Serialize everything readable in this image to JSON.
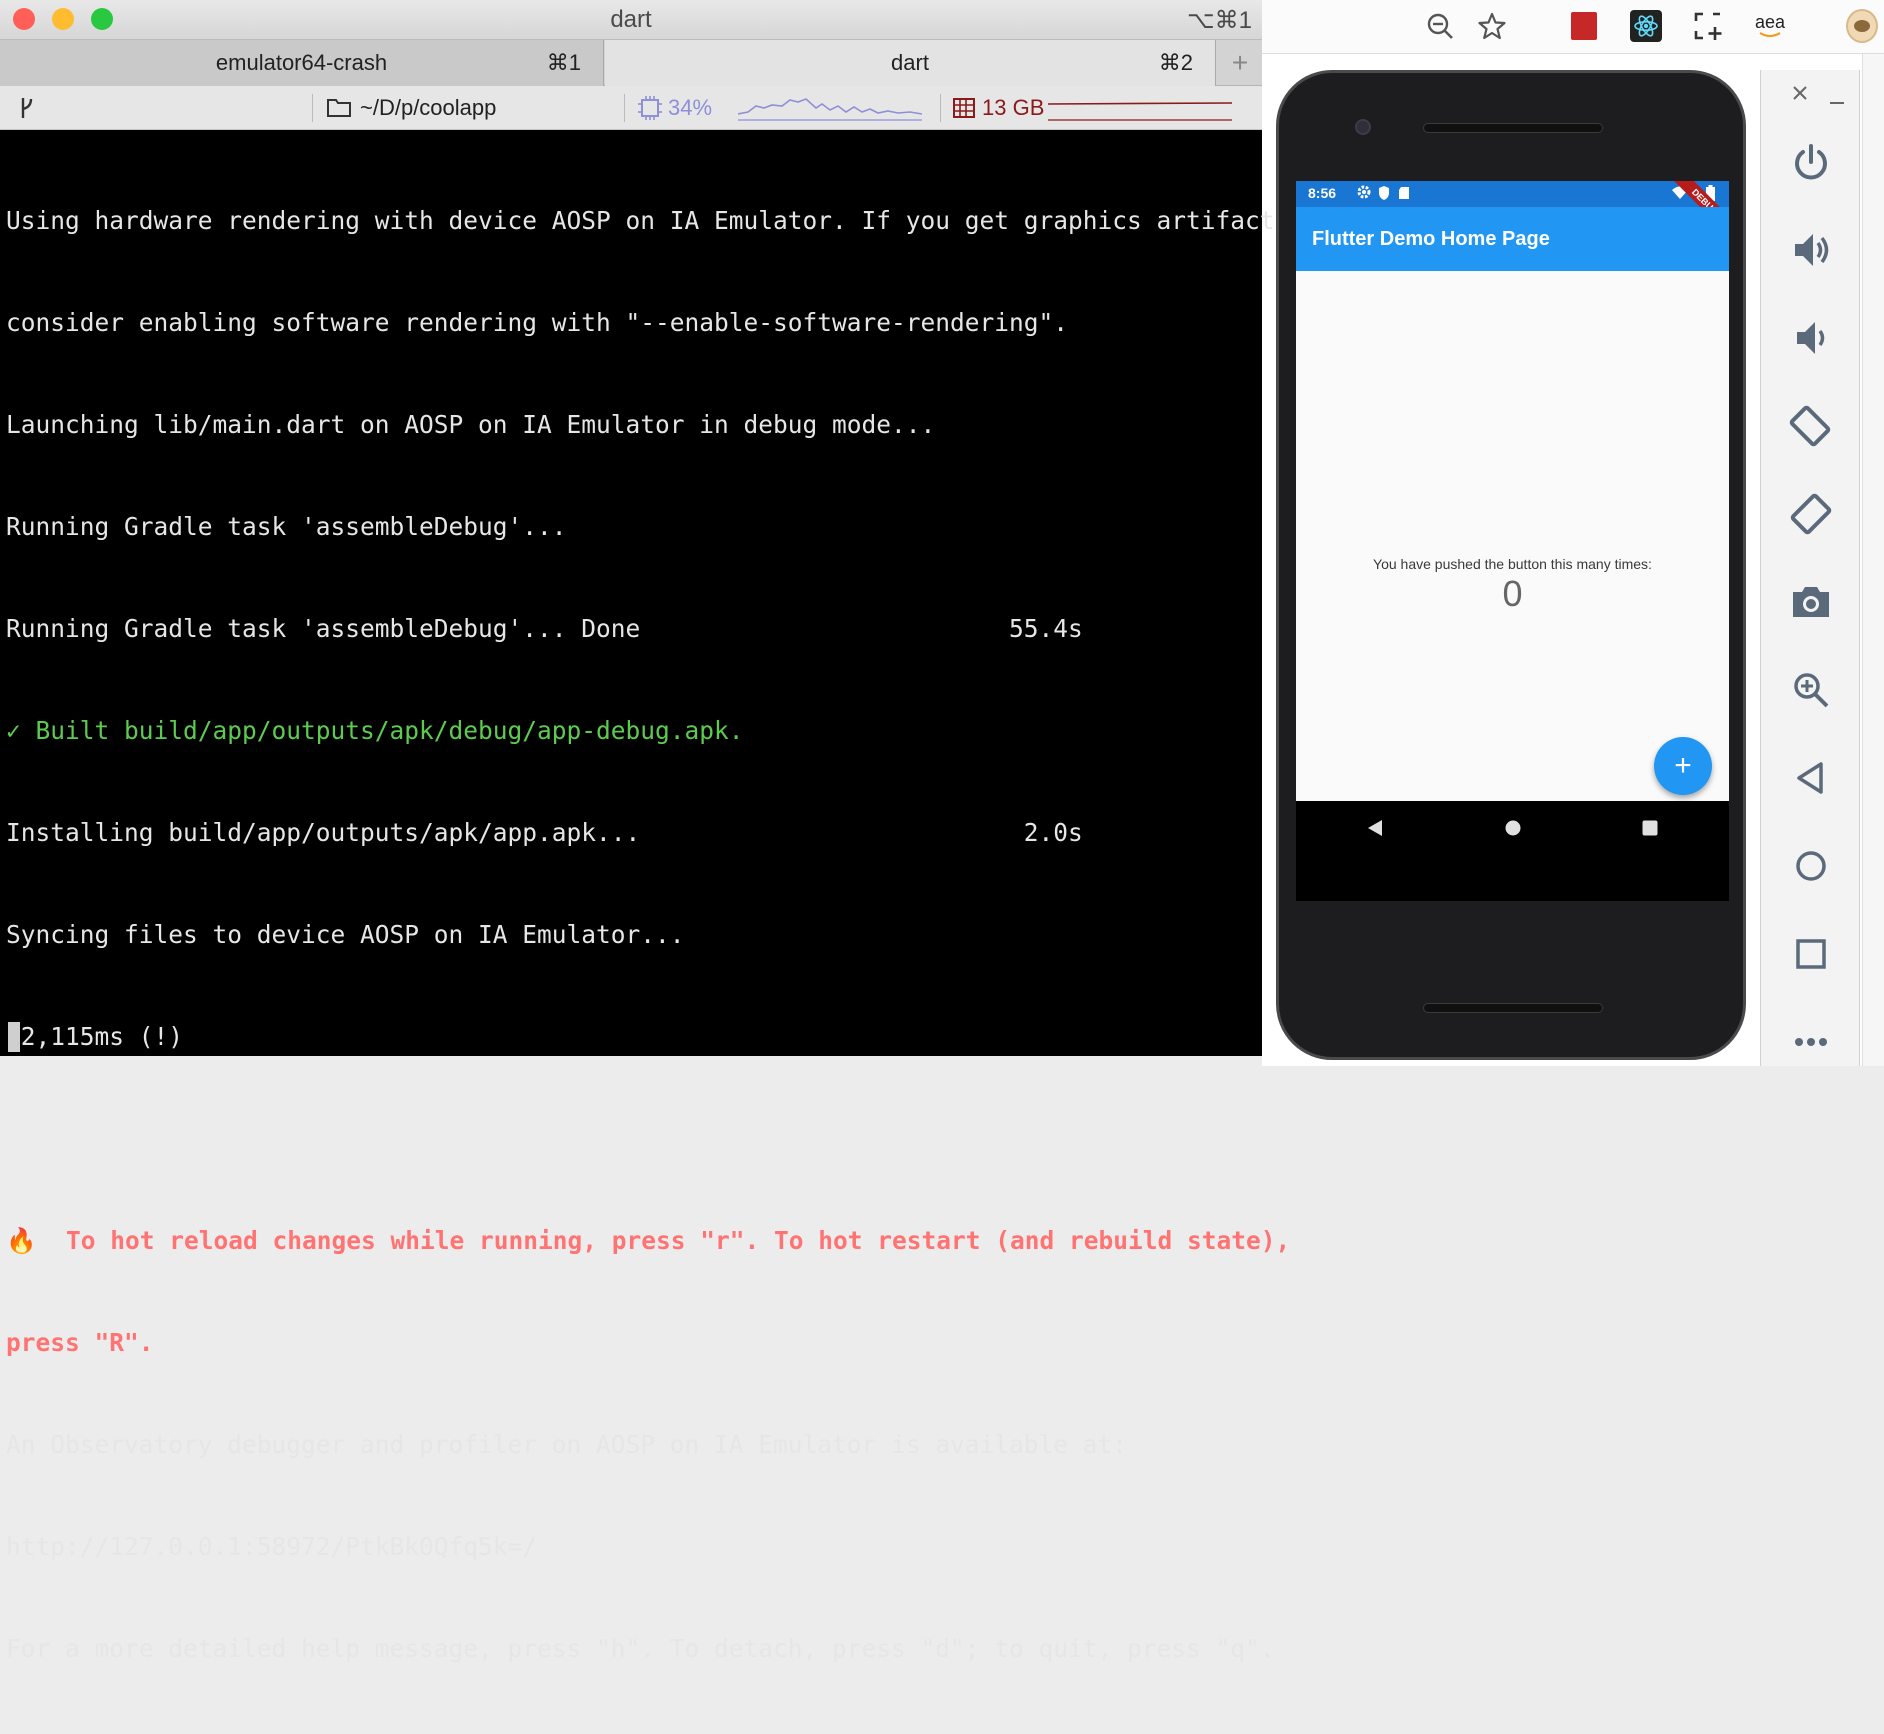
{
  "window": {
    "title": "dart",
    "shortcut": "⌥⌘1",
    "traffic_light_colors": [
      "#ff5f57",
      "#febc2e",
      "#28c840"
    ]
  },
  "tabs": [
    {
      "label": "emulator64-crash",
      "shortcut": "⌘1"
    },
    {
      "label": "dart",
      "shortcut": "⌘2"
    }
  ],
  "statusbar": {
    "path": "~/D/p/coolapp",
    "cpu": "34%",
    "memory": "13 GB",
    "cpu_color": "#8d90d8",
    "memory_color": "#8b1a1a"
  },
  "terminal": {
    "lines": [
      {
        "text": "Using hardware rendering with device AOSP on IA Emulator. If you get graphics artifacts,",
        "style": ""
      },
      {
        "text": "consider enabling software rendering with \"--enable-software-rendering\".",
        "style": ""
      },
      {
        "text": "Launching lib/main.dart on AOSP on IA Emulator in debug mode...",
        "style": ""
      },
      {
        "text": "Running Gradle task 'assembleDebug'...",
        "style": ""
      },
      {
        "text": "Running Gradle task 'assembleDebug'... Done                         55.4s",
        "style": ""
      },
      {
        "text": "✓ Built build/app/outputs/apk/debug/app-debug.apk.",
        "style": "green"
      },
      {
        "text": "Installing build/app/outputs/apk/app.apk...                          2.0s",
        "style": ""
      },
      {
        "text": "Syncing files to device AOSP on IA Emulator...",
        "style": ""
      },
      {
        "text": "12,115ms (!)",
        "style": ""
      },
      {
        "text": "",
        "style": ""
      },
      {
        "text": "🔥  To hot reload changes while running, press \"r\". To hot restart (and rebuild state),",
        "style": "red"
      },
      {
        "text": "press \"R\".",
        "style": "red"
      },
      {
        "text": "An Observatory debugger and profiler on AOSP on IA Emulator is available at:",
        "style": ""
      },
      {
        "text": "http://127.0.0.1:58972/PtkBk0Qfq5k=/",
        "style": ""
      },
      {
        "text": "For a more detailed help message, press \"h\". To detach, press \"d\"; to quit, press \"q\".",
        "style": ""
      }
    ]
  },
  "phone": {
    "status_time": "8:56",
    "app_title": "Flutter Demo Home Page",
    "message": "You have pushed the button this many times:",
    "counter": "0",
    "fab_label": "+",
    "debug_ribbon": "DEBUG",
    "primary_color": "#2196f3",
    "status_color": "#1976d2"
  },
  "browser": {
    "amazon_label": "aea"
  },
  "emulator_toolbar": {
    "buttons": [
      "power-icon",
      "volume-up-icon",
      "volume-down-icon",
      "rotate-left-icon",
      "rotate-right-icon",
      "camera-icon",
      "zoom-icon",
      "back-icon",
      "home-icon",
      "overview-icon",
      "more-icon"
    ]
  }
}
